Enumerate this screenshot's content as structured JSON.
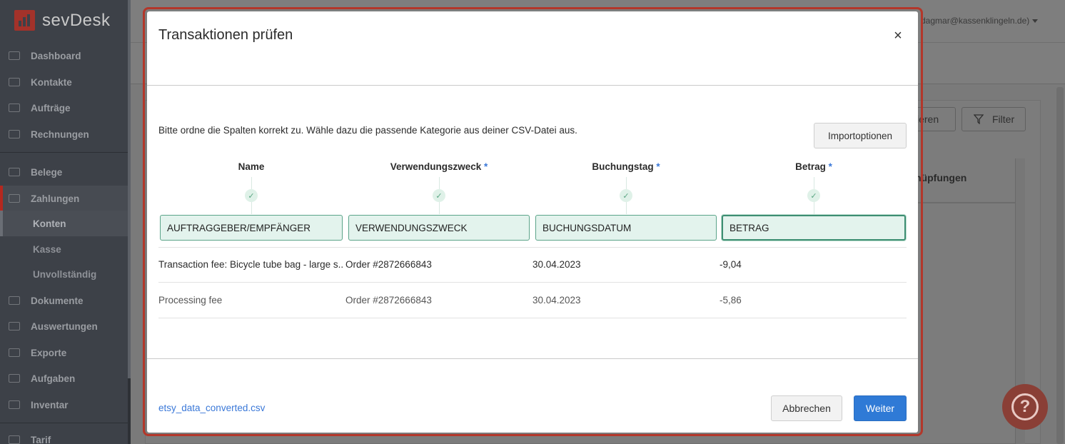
{
  "app": {
    "logo_text": "sevDesk",
    "user_email": "dagmar@kassenklingeln.de)"
  },
  "sidebar": {
    "items": [
      {
        "label": "Dashboard",
        "icon": "dashboard-icon"
      },
      {
        "label": "Kontakte",
        "icon": "contacts-icon"
      },
      {
        "label": "Aufträge",
        "icon": "folder-icon"
      },
      {
        "label": "Rechnungen",
        "icon": "document-icon"
      },
      {
        "label": "Belege",
        "icon": "receipt-icon"
      },
      {
        "label": "Zahlungen",
        "icon": "card-icon"
      },
      {
        "label": "Dokumente",
        "icon": "documents-icon"
      },
      {
        "label": "Auswertungen",
        "icon": "report-icon"
      },
      {
        "label": "Exporte",
        "icon": "export-icon"
      },
      {
        "label": "Aufgaben",
        "icon": "checkmark-icon"
      },
      {
        "label": "Inventar",
        "icon": "box-icon"
      },
      {
        "label": "Tarif",
        "icon": "tariff-icon"
      }
    ],
    "sub_items": [
      {
        "label": "Konten"
      },
      {
        "label": "Kasse"
      },
      {
        "label": "Unvollständig"
      }
    ]
  },
  "background": {
    "btn_partial": "ieren",
    "filter_label": "Filter",
    "col_header_partial": "nüpfungen"
  },
  "modal": {
    "title": "Transaktionen prüfen",
    "close_glyph": "×",
    "intro": "Bitte ordne die Spalten korrekt zu. Wähle dazu die passende Kategorie aus deiner CSV-Datei aus.",
    "import_options_label": "Importoptionen",
    "columns": [
      {
        "header": "Name",
        "required": false,
        "mapped": "AUFTRAGGEBER/EMPFÄNGER"
      },
      {
        "header": "Verwendungszweck",
        "required": true,
        "mapped": "VERWENDUNGSZWECK"
      },
      {
        "header": "Buchungstag",
        "required": true,
        "mapped": "BUCHUNGSDATUM"
      },
      {
        "header": "Betrag",
        "required": true,
        "mapped": "BETRAG"
      }
    ],
    "required_marker": "*",
    "rows": [
      {
        "name": "Transaction fee: Bicycle tube bag - large s...",
        "purpose": "Order #2872666843",
        "date": "30.04.2023",
        "amount": "-9,04"
      },
      {
        "name": "Processing fee",
        "purpose": "Order #2872666843",
        "date": "30.04.2023",
        "amount": "-5,86"
      }
    ],
    "file_name": "etsy_data_converted.csv",
    "cancel_label": "Abbrechen",
    "next_label": "Weiter"
  },
  "colors": {
    "brand": "#a3322a",
    "primary": "#2f7ad6",
    "mapped_bg": "#e3f3ed",
    "mapped_border": "#5ba489"
  }
}
